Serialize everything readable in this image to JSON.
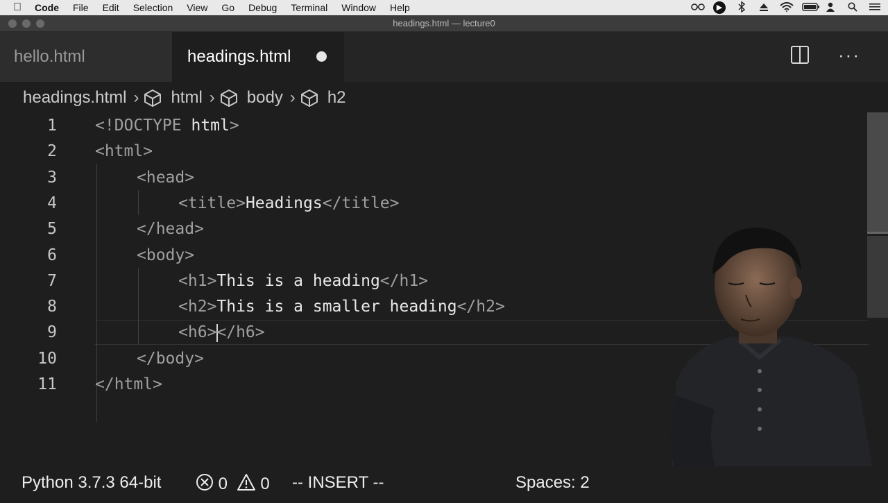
{
  "menubar": {
    "app": "Code",
    "items": [
      "File",
      "Edit",
      "Selection",
      "View",
      "Go",
      "Debug",
      "Terminal",
      "Window",
      "Help"
    ],
    "tray_icons": [
      "glasses-icon",
      "record-icon",
      "bluetooth-icon",
      "eject-icon",
      "wifi-icon",
      "battery-icon",
      "user-icon",
      "search-icon",
      "list-icon"
    ]
  },
  "window": {
    "title": "headings.html — lecture0"
  },
  "tabs": [
    {
      "label": "hello.html",
      "active": false
    },
    {
      "label": "headings.html",
      "active": true,
      "dirty": true
    }
  ],
  "breadcrumb": [
    "headings.html",
    "html",
    "body",
    "h2"
  ],
  "editor": {
    "lines": [
      {
        "n": "1",
        "indent": 0,
        "parts": [
          [
            "tag",
            "<!DOCTYPE "
          ],
          [
            "txt",
            "html"
          ],
          [
            "tag",
            ">"
          ]
        ]
      },
      {
        "n": "2",
        "indent": 0,
        "parts": [
          [
            "tag",
            "<html>"
          ]
        ]
      },
      {
        "n": "3",
        "indent": 1,
        "parts": [
          [
            "tag",
            "<head>"
          ]
        ]
      },
      {
        "n": "4",
        "indent": 2,
        "parts": [
          [
            "tag",
            "<title>"
          ],
          [
            "txt",
            "Headings"
          ],
          [
            "tag",
            "</title>"
          ]
        ]
      },
      {
        "n": "5",
        "indent": 1,
        "parts": [
          [
            "tag",
            "</head>"
          ]
        ]
      },
      {
        "n": "6",
        "indent": 1,
        "parts": [
          [
            "tag",
            "<body>"
          ]
        ]
      },
      {
        "n": "7",
        "indent": 2,
        "parts": [
          [
            "tag",
            "<h1>"
          ],
          [
            "txt",
            "This is a heading"
          ],
          [
            "tag",
            "</h1>"
          ]
        ]
      },
      {
        "n": "8",
        "indent": 2,
        "parts": [
          [
            "tag",
            "<h2>"
          ],
          [
            "txt",
            "This is a smaller heading"
          ],
          [
            "tag",
            "</h2>"
          ]
        ]
      },
      {
        "n": "9",
        "indent": 2,
        "parts": [
          [
            "tag",
            "<h6>"
          ],
          [
            "cursor",
            ""
          ],
          [
            "tag",
            "</h6>"
          ]
        ],
        "current": true
      },
      {
        "n": "10",
        "indent": 1,
        "parts": [
          [
            "tag",
            "</body>"
          ]
        ]
      },
      {
        "n": "11",
        "indent": 0,
        "parts": [
          [
            "tag",
            "</html>"
          ]
        ]
      }
    ]
  },
  "statusbar": {
    "python": "Python 3.7.3 64-bit",
    "errors": "0",
    "warnings": "0",
    "mode": "-- INSERT --",
    "spaces": "Spaces: 2"
  }
}
